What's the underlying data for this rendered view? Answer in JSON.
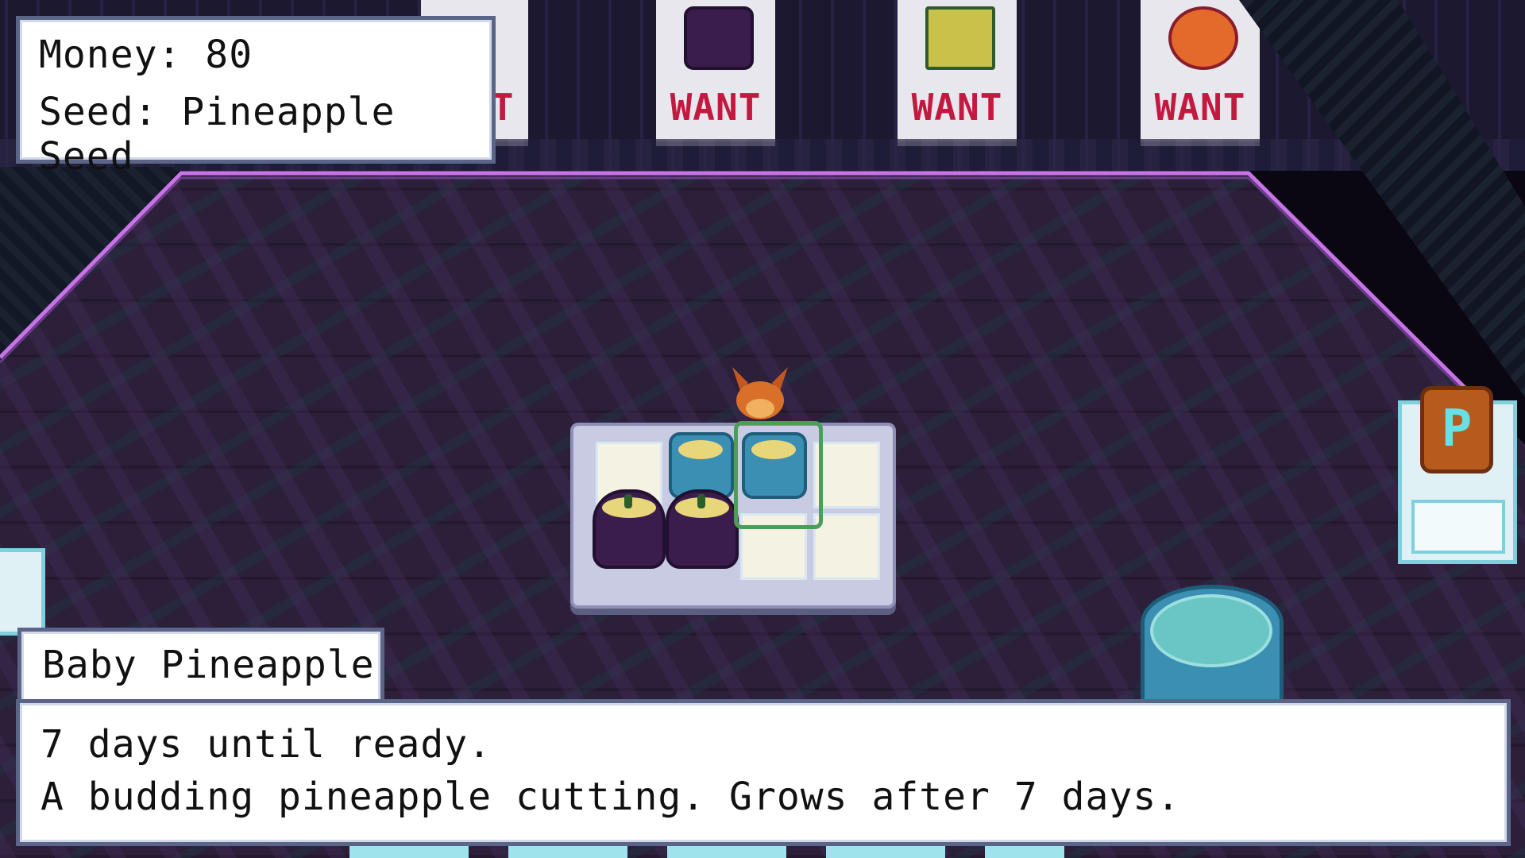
{
  "hud": {
    "money_label": "Money: 80",
    "seed_label": "Seed: Pineapple Seed"
  },
  "posters": [
    {
      "text": "IT",
      "icon": "partial-poster"
    },
    {
      "text": "WANT",
      "icon": "eggplant-crop-icon"
    },
    {
      "text": "WANT",
      "icon": "corn-crop-icon"
    },
    {
      "text": "WANT",
      "icon": "pepper-crop-icon"
    }
  ],
  "dialog": {
    "speaker": "Baby Pineapple",
    "line1": "7 days until ready.",
    "line2": "A budding pineapple cutting. Grows after 7 days."
  },
  "bag": {
    "letter": "P"
  },
  "colors": {
    "want_red": "#c3193f",
    "panel_border": "#5b6588",
    "cursor_green": "#4d9d5a",
    "floor": "#261b34"
  }
}
